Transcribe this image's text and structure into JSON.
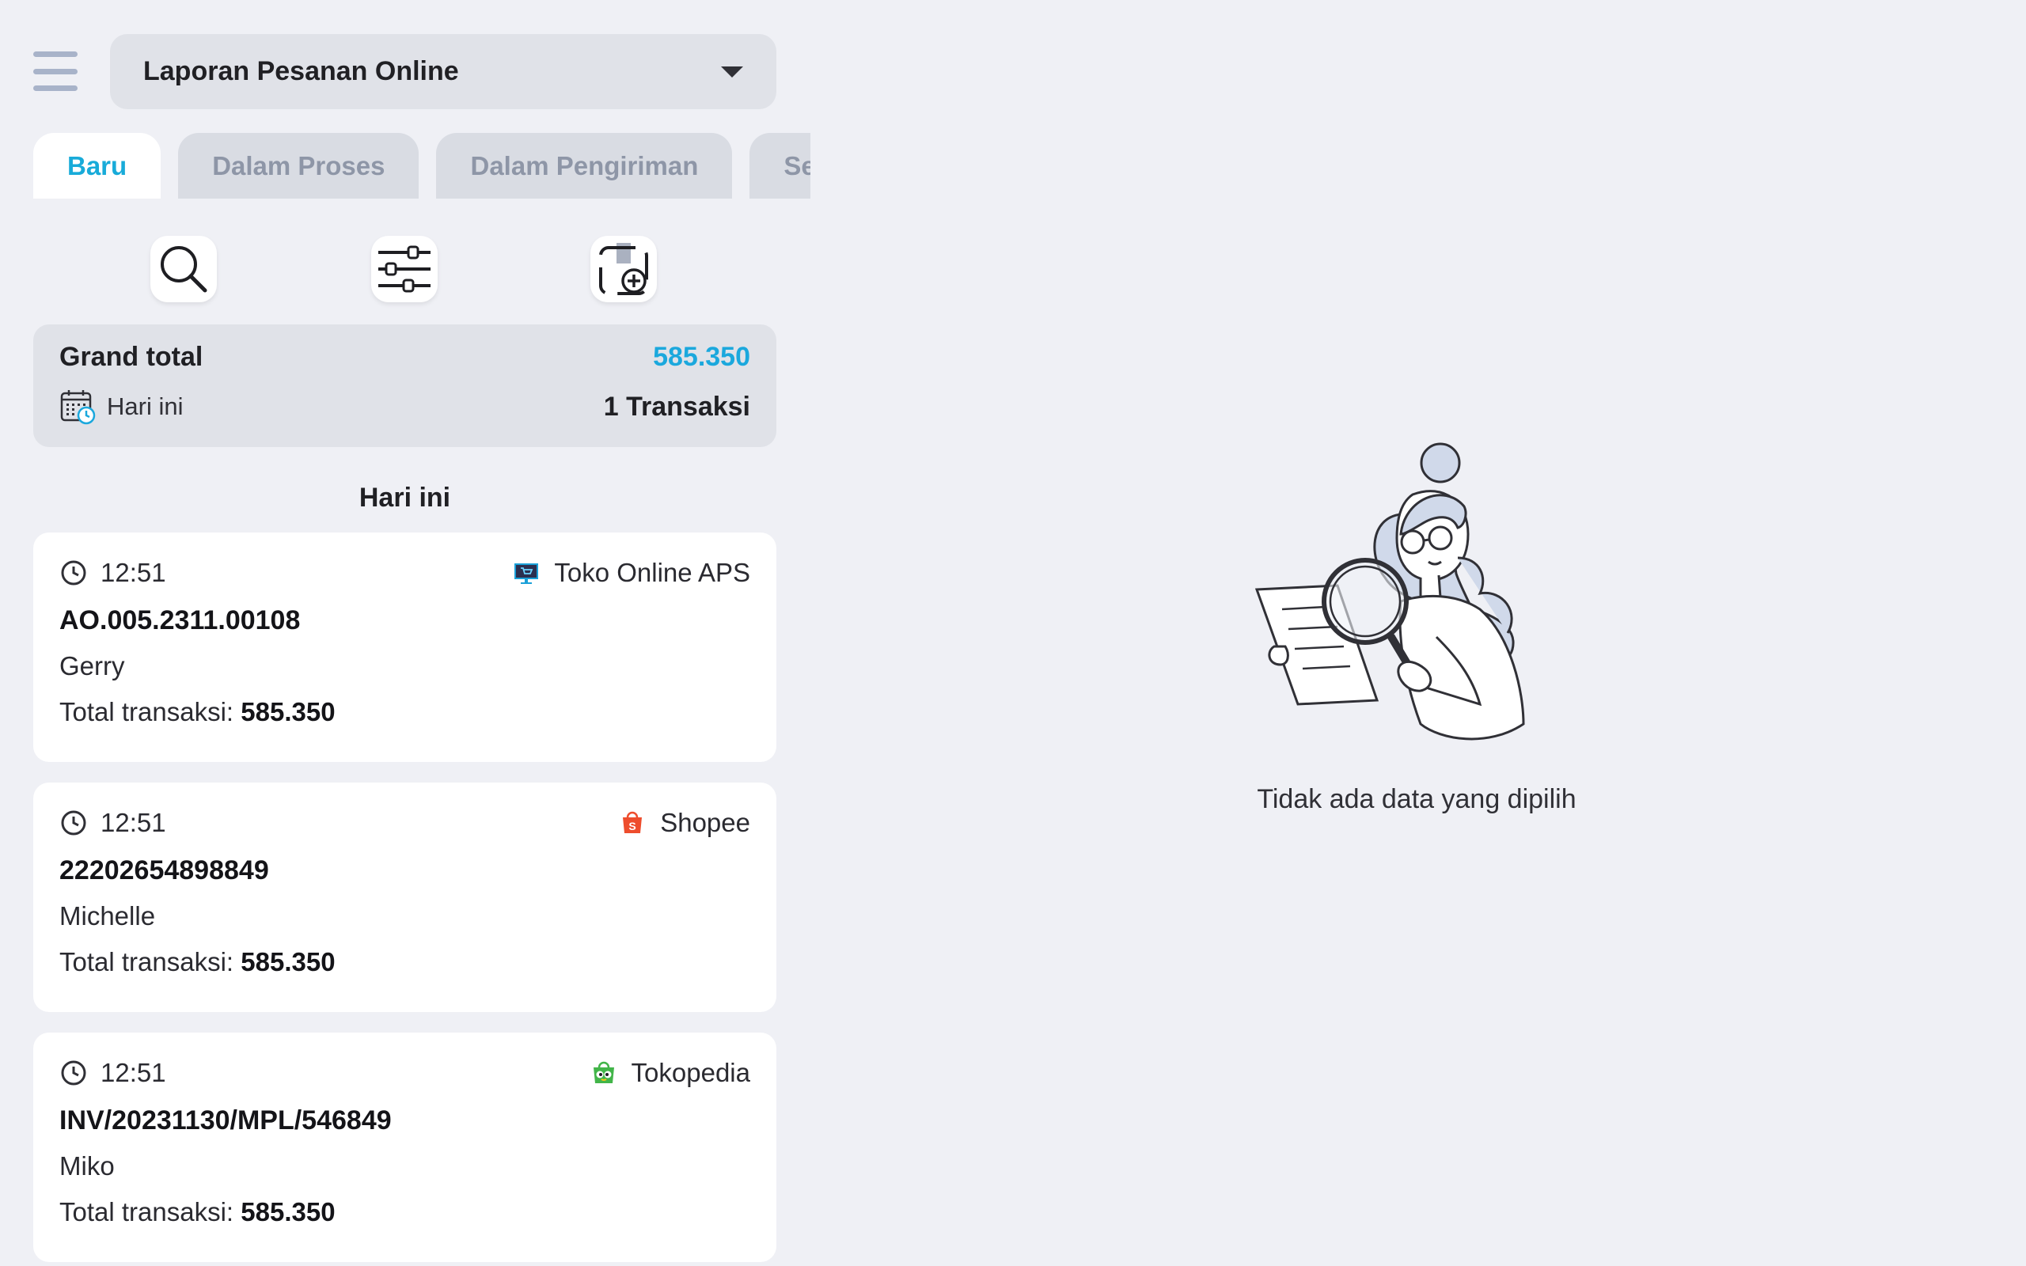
{
  "header": {
    "report_title": "Laporan Pesanan Online"
  },
  "tabs": [
    {
      "label": "Baru",
      "active": true
    },
    {
      "label": "Dalam Proses",
      "active": false
    },
    {
      "label": "Dalam Pengiriman",
      "active": false
    },
    {
      "label": "Selesai",
      "active": false
    }
  ],
  "toolbar": {
    "search_icon": "search-icon",
    "filter_icon": "sliders-icon",
    "add_icon": "add-document-icon"
  },
  "summary": {
    "grand_total_label": "Grand total",
    "grand_total_value": "585.350",
    "period_label": "Hari ini",
    "transaction_count": "1 Transaksi"
  },
  "section_title": "Hari ini",
  "orders": [
    {
      "time": "12:51",
      "store": "Toko Online APS",
      "store_icon": "monitor-cart-icon",
      "order_no": "AO.005.2311.00108",
      "customer": "Gerry",
      "total_label": "Total transaksi:",
      "total_value": "585.350"
    },
    {
      "time": "12:51",
      "store": "Shopee",
      "store_icon": "shopee-bag-icon",
      "order_no": "22202654898849",
      "customer": "Michelle",
      "total_label": "Total transaksi:",
      "total_value": "585.350"
    },
    {
      "time": "12:51",
      "store": "Tokopedia",
      "store_icon": "tokopedia-bag-icon",
      "order_no": "INV/20231130/MPL/546849",
      "customer": "Miko",
      "total_label": "Total transaksi:",
      "total_value": "585.350"
    }
  ],
  "empty_state": {
    "message": "Tidak ada data yang dipilih"
  },
  "colors": {
    "background": "#eff0f5",
    "accent": "#1ba8dd",
    "tab_inactive_text": "#8e96a7",
    "panel": "#e0e2e8"
  }
}
